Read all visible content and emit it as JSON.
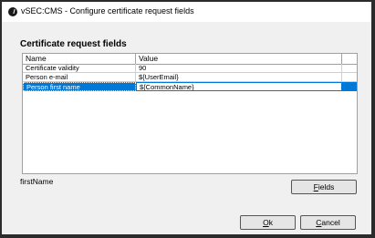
{
  "window": {
    "title": "vSEC:CMS - Configure certificate request fields"
  },
  "section_heading": "Certificate request fields",
  "table": {
    "columns": [
      "Name",
      "Value"
    ],
    "rows": [
      {
        "name": "Certificate validity",
        "value": "90"
      },
      {
        "name": "Person e-mail",
        "value": "${UserEmail}"
      },
      {
        "name": "Person first name",
        "value": "${CommonName}"
      }
    ],
    "selected_row_index": 2
  },
  "selected_field_name": "firstName",
  "buttons": {
    "fields": {
      "mnemonic": "F",
      "rest": "ields"
    },
    "ok": {
      "mnemonic": "O",
      "rest": "k"
    },
    "cancel": {
      "mnemonic": "C",
      "rest": "ancel"
    }
  },
  "colors": {
    "selection": "#0078d7",
    "dialog_bg": "#f0f0f0"
  }
}
